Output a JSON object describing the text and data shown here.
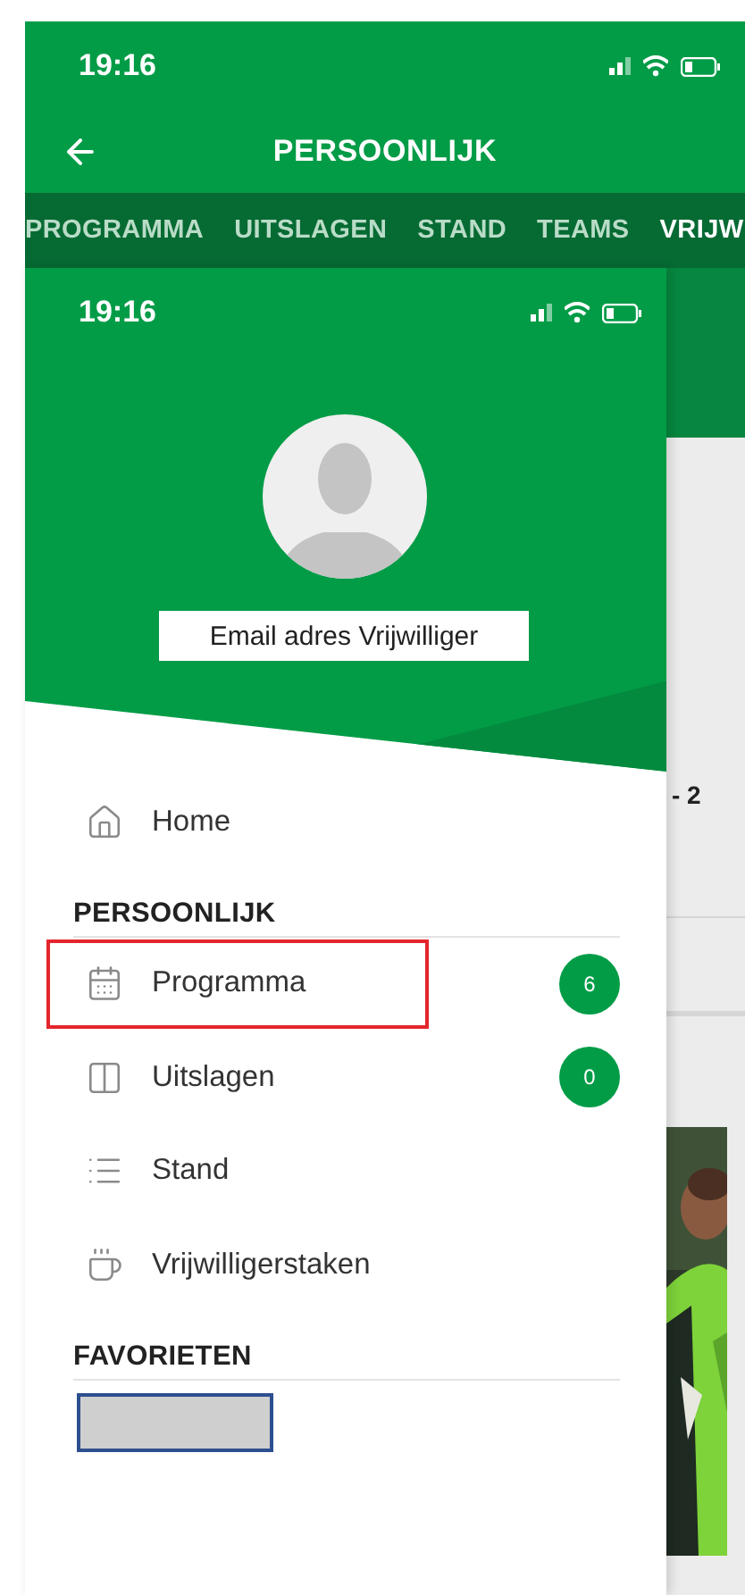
{
  "status_bar": {
    "time": "19:16"
  },
  "header": {
    "title": "PERSOONLIJK"
  },
  "tabs": [
    {
      "label": "PROGRAMMA",
      "selected": false
    },
    {
      "label": "UITSLAGEN",
      "selected": false
    },
    {
      "label": "STAND",
      "selected": false
    },
    {
      "label": "TEAMS",
      "selected": false
    },
    {
      "label": "VRIJW",
      "selected": true
    }
  ],
  "background": {
    "score_text": "- 2"
  },
  "drawer": {
    "status_bar": {
      "time": "19:16"
    },
    "profile": {
      "email": "Email adres Vrijwilliger"
    },
    "home": {
      "label": "Home",
      "kind": "home",
      "highlighted": false
    },
    "sections": [
      {
        "title": "PERSOONLIJK",
        "items": [
          {
            "kind": "calendar",
            "label": "Programma",
            "badge": "6",
            "highlighted": true
          },
          {
            "kind": "results",
            "label": "Uitslagen",
            "badge": "0",
            "highlighted": false
          },
          {
            "kind": "list",
            "label": "Stand",
            "highlighted": false
          },
          {
            "kind": "cup",
            "label": "Vrijwilligerstaken",
            "highlighted": false
          }
        ]
      },
      {
        "title": "FAVORIETEN",
        "items": [
          {
            "kind": "redacted",
            "highlighted": false
          }
        ]
      }
    ]
  }
}
